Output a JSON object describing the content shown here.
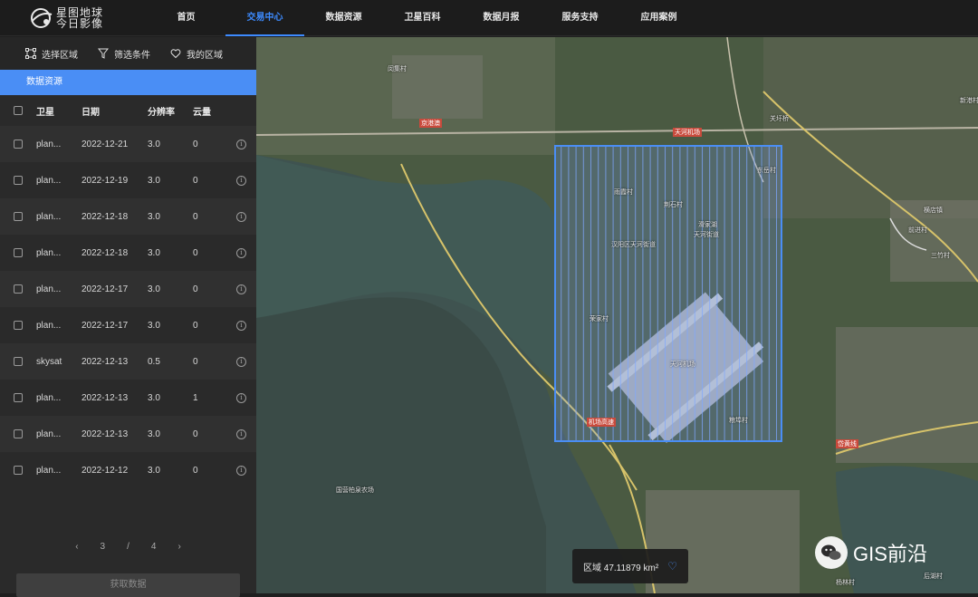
{
  "logo": {
    "line1": "星图地球",
    "line2": "今日影像"
  },
  "nav": [
    "首页",
    "交易中心",
    "数据资源",
    "卫星百科",
    "数据月报",
    "服务支持",
    "应用案例"
  ],
  "nav_active_index": 1,
  "tools": [
    {
      "icon": "select-area-icon",
      "label": "选择区域"
    },
    {
      "icon": "filter-icon",
      "label": "筛选条件"
    },
    {
      "icon": "heart-icon",
      "label": "我的区域"
    }
  ],
  "section_title": "数据资源",
  "table": {
    "headers": [
      "卫星",
      "日期",
      "分辨率",
      "云量"
    ],
    "rows": [
      [
        "plan...",
        "2022-12-21",
        "3.0",
        "0"
      ],
      [
        "plan...",
        "2022-12-19",
        "3.0",
        "0"
      ],
      [
        "plan...",
        "2022-12-18",
        "3.0",
        "0"
      ],
      [
        "plan...",
        "2022-12-18",
        "3.0",
        "0"
      ],
      [
        "plan...",
        "2022-12-17",
        "3.0",
        "0"
      ],
      [
        "plan...",
        "2022-12-17",
        "3.0",
        "0"
      ],
      [
        "skysat",
        "2022-12-13",
        "0.5",
        "0"
      ],
      [
        "plan...",
        "2022-12-13",
        "3.0",
        "1"
      ],
      [
        "plan...",
        "2022-12-13",
        "3.0",
        "0"
      ],
      [
        "plan...",
        "2022-12-12",
        "3.0",
        "0"
      ]
    ]
  },
  "pager": {
    "prev": "‹",
    "current": "3",
    "sep": "/",
    "total": "4",
    "next": "›"
  },
  "get_button": "获取数据",
  "area": {
    "label": "区域 47.11879 km²"
  },
  "watermark": "GIS前沿",
  "map_labels": [
    "闵集村",
    "雨霞村",
    "荆石村",
    "关圩桥",
    "荣家村",
    "天河机场",
    "横店镇",
    "汉阳区天河街道",
    "滑家湖",
    "天河街道",
    "东岳村",
    "三竹村",
    "粮埠村",
    "国营柏泉农场",
    "前进村",
    "后湖村",
    "杨林村",
    "新港村"
  ],
  "road_labels": [
    "京港澳",
    "天河机场",
    "岱黄线",
    "机场高速"
  ],
  "colors": {
    "accent": "#3d8bff",
    "selection": "#4a8ef5"
  }
}
